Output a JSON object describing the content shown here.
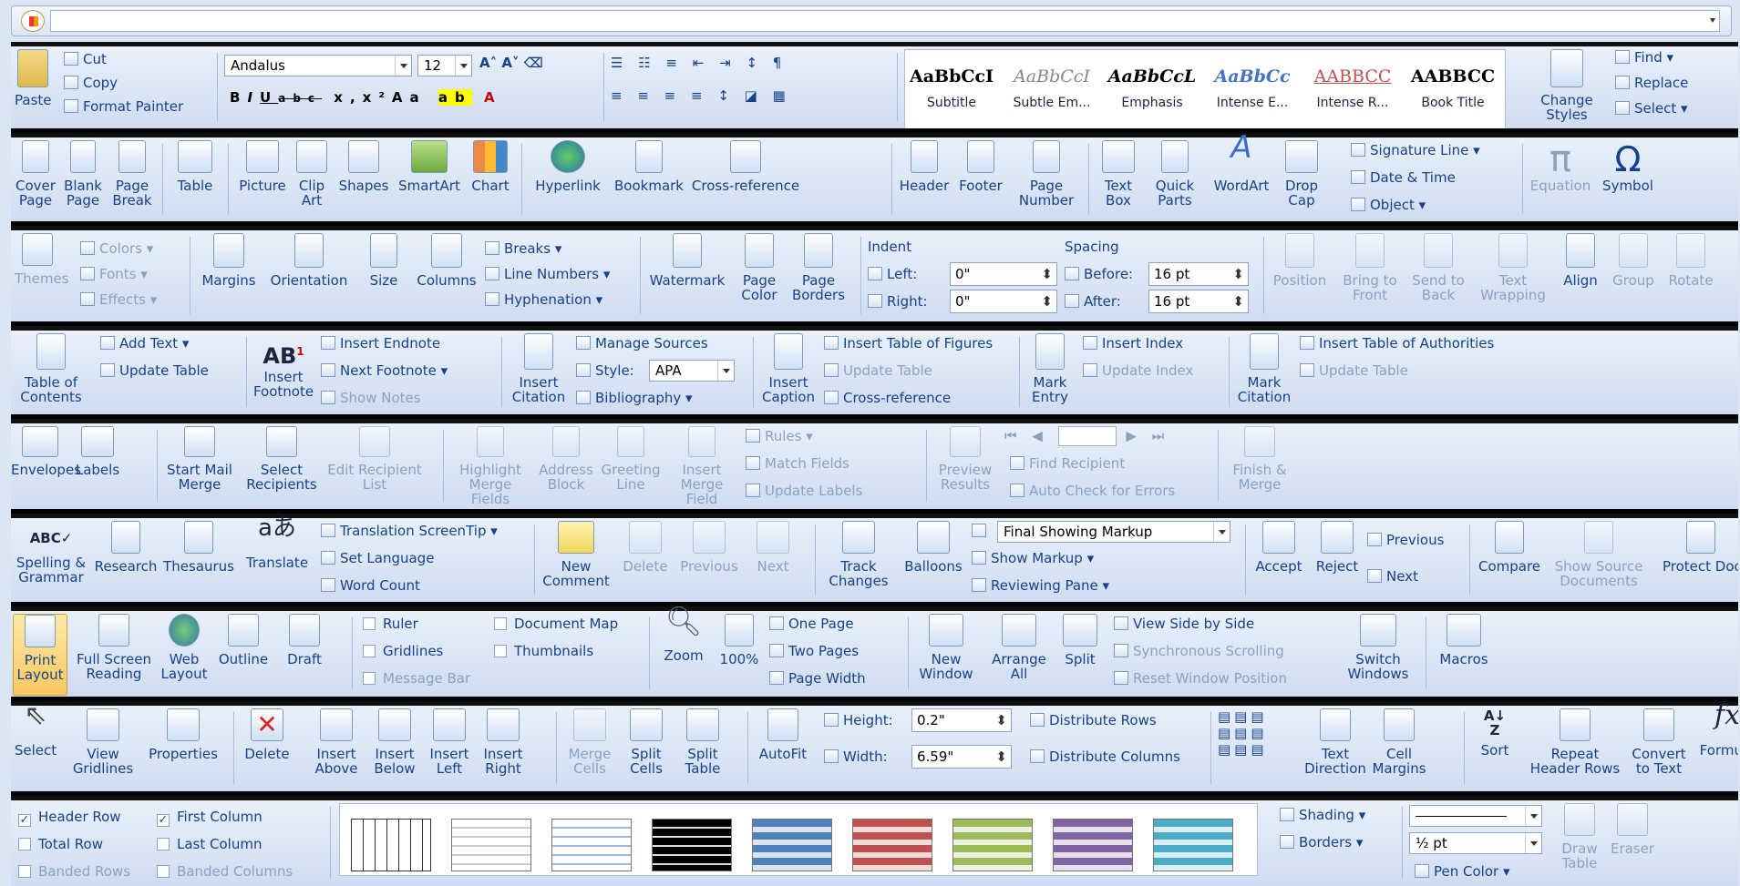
{
  "top": {
    "office_icon": "office-button-icon"
  },
  "home": {
    "paste": "Paste",
    "cut": "Cut",
    "copy": "Copy",
    "format_painter": "Format Painter",
    "font": "Andalus",
    "size": "12",
    "bold": "B",
    "italic": "I",
    "underline": "U",
    "strike": "abc",
    "sub": "x,",
    "sup": "x²",
    "case": "Aa",
    "styles": [
      {
        "sample": "AaBbCcI",
        "name": "Subtitle",
        "color": "#000000"
      },
      {
        "sample": "AaBbCcI",
        "name": "Subtle Em...",
        "color": "#888888"
      },
      {
        "sample": "AaBbCcL",
        "name": "Emphasis",
        "color": "#000000"
      },
      {
        "sample": "AaBbCc",
        "name": "Intense E...",
        "color": "#4472c4"
      },
      {
        "sample": "AABBCC",
        "name": "Intense R...",
        "color": "#c0504d"
      },
      {
        "sample": "AABBCC",
        "name": "Book Title",
        "color": "#000000"
      }
    ],
    "change_styles": "Change Styles",
    "find": "Find",
    "replace": "Replace",
    "select": "Select"
  },
  "insert": {
    "items": [
      "Cover Page",
      "Blank Page",
      "Page Break",
      "Table",
      "Picture",
      "Clip Art",
      "Shapes",
      "SmartArt",
      "Chart",
      "Hyperlink",
      "Bookmark",
      "Cross-reference",
      "Header",
      "Footer",
      "Page Number",
      "Text Box",
      "Quick Parts",
      "WordArt",
      "Drop Cap",
      "Equation",
      "Symbol"
    ],
    "signature": "Signature Line",
    "date": "Date & Time",
    "object": "Object"
  },
  "layout": {
    "themes": "Themes",
    "colors": "Colors",
    "fonts": "Fonts",
    "effects": "Effects",
    "items": [
      "Margins",
      "Orientation",
      "Size",
      "Columns",
      "Watermark",
      "Page Color",
      "Page Borders",
      "Position",
      "Bring to Front",
      "Send to Back",
      "Text Wrapping",
      "Align",
      "Group",
      "Rotate"
    ],
    "breaks": "Breaks",
    "line_numbers": "Line Numbers",
    "hyphenation": "Hyphenation",
    "indent": "Indent",
    "left": "Left:",
    "right": "Right:",
    "left_val": "0\"",
    "right_val": "0\"",
    "spacing": "Spacing",
    "before": "Before:",
    "after": "After:",
    "before_val": "16 pt",
    "after_val": "16 pt"
  },
  "references": {
    "toc": "Table of Contents",
    "add_text": "Add Text",
    "update_table": "Update Table",
    "insert_footnote": "Insert Footnote",
    "insert_endnote": "Insert Endnote",
    "next_footnote": "Next Footnote",
    "show_notes": "Show Notes",
    "insert_citation": "Insert Citation",
    "manage_sources": "Manage Sources",
    "style": "Style:",
    "style_val": "APA",
    "bibliography": "Bibliography",
    "insert_caption": "Insert Caption",
    "insert_tof": "Insert Table of Figures",
    "update_table2": "Update Table",
    "cross_ref": "Cross-reference",
    "mark_entry": "Mark Entry",
    "insert_index": "Insert Index",
    "update_index": "Update Index",
    "mark_citation": "Mark Citation",
    "insert_toa": "Insert Table of Authorities",
    "update_table3": "Update Table"
  },
  "mailings": {
    "items": [
      "Envelopes",
      "Labels",
      "Start Mail Merge",
      "Select Recipients",
      "Edit Recipient List",
      "Highlight Merge Fields",
      "Address Block",
      "Greeting Line",
      "Insert Merge Field",
      "Preview Results",
      "Finish & Merge"
    ],
    "rules": "Rules",
    "match": "Match Fields",
    "update_labels": "Update Labels",
    "find_recipient": "Find Recipient",
    "auto_check": "Auto Check for Errors"
  },
  "review": {
    "items": [
      "Spelling & Grammar",
      "Research",
      "Thesaurus",
      "Translate",
      "New Comment",
      "Delete",
      "Previous",
      "Next",
      "Track Changes",
      "Balloons",
      "Accept",
      "Reject",
      "Compare",
      "Show Source Documents",
      "Protect Document"
    ],
    "screentip": "Translation ScreenTip",
    "set_language": "Set Language",
    "word_count": "Word Count",
    "markup": "Final Showing Markup",
    "show_markup": "Show Markup",
    "reviewing_pane": "Reviewing Pane",
    "previous": "Previous",
    "next": "Next"
  },
  "view": {
    "items": [
      "Print Layout",
      "Full Screen Reading",
      "Web Layout",
      "Outline",
      "Draft",
      "Zoom",
      "100%",
      "New Window",
      "Arrange All",
      "Split",
      "Switch Windows",
      "Macros"
    ],
    "ruler": "Ruler",
    "gridlines": "Gridlines",
    "message_bar": "Message Bar",
    "doc_map": "Document Map",
    "thumbnails": "Thumbnails",
    "one_page": "One Page",
    "two_pages": "Two Pages",
    "page_width": "Page Width",
    "side_by_side": "View Side by Side",
    "sync_scroll": "Synchronous Scrolling",
    "reset_pos": "Reset Window Position"
  },
  "tablelayout": {
    "items": [
      "Select",
      "View Gridlines",
      "Properties",
      "Delete",
      "Insert Above",
      "Insert Below",
      "Insert Left",
      "Insert Right",
      "Merge Cells",
      "Split Cells",
      "Split Table",
      "AutoFit",
      "Text Direction",
      "Cell Margins",
      "Sort",
      "Repeat Header Rows",
      "Convert to Text",
      "Formula"
    ],
    "height": "Height:",
    "width": "Width:",
    "height_val": "0.2\"",
    "width_val": "6.59\"",
    "dist_rows": "Distribute Rows",
    "dist_cols": "Distribute Columns"
  },
  "design": {
    "header_row": "Header Row",
    "first_col": "First Column",
    "total_row": "Total Row",
    "last_col": "Last Column",
    "banded_rows": "Banded Rows",
    "banded_cols": "Banded Columns",
    "shading": "Shading",
    "borders": "Borders",
    "pen_weight": "½ pt",
    "pen_color": "Pen Color",
    "draw_table": "Draw Table",
    "eraser": "Eraser"
  }
}
